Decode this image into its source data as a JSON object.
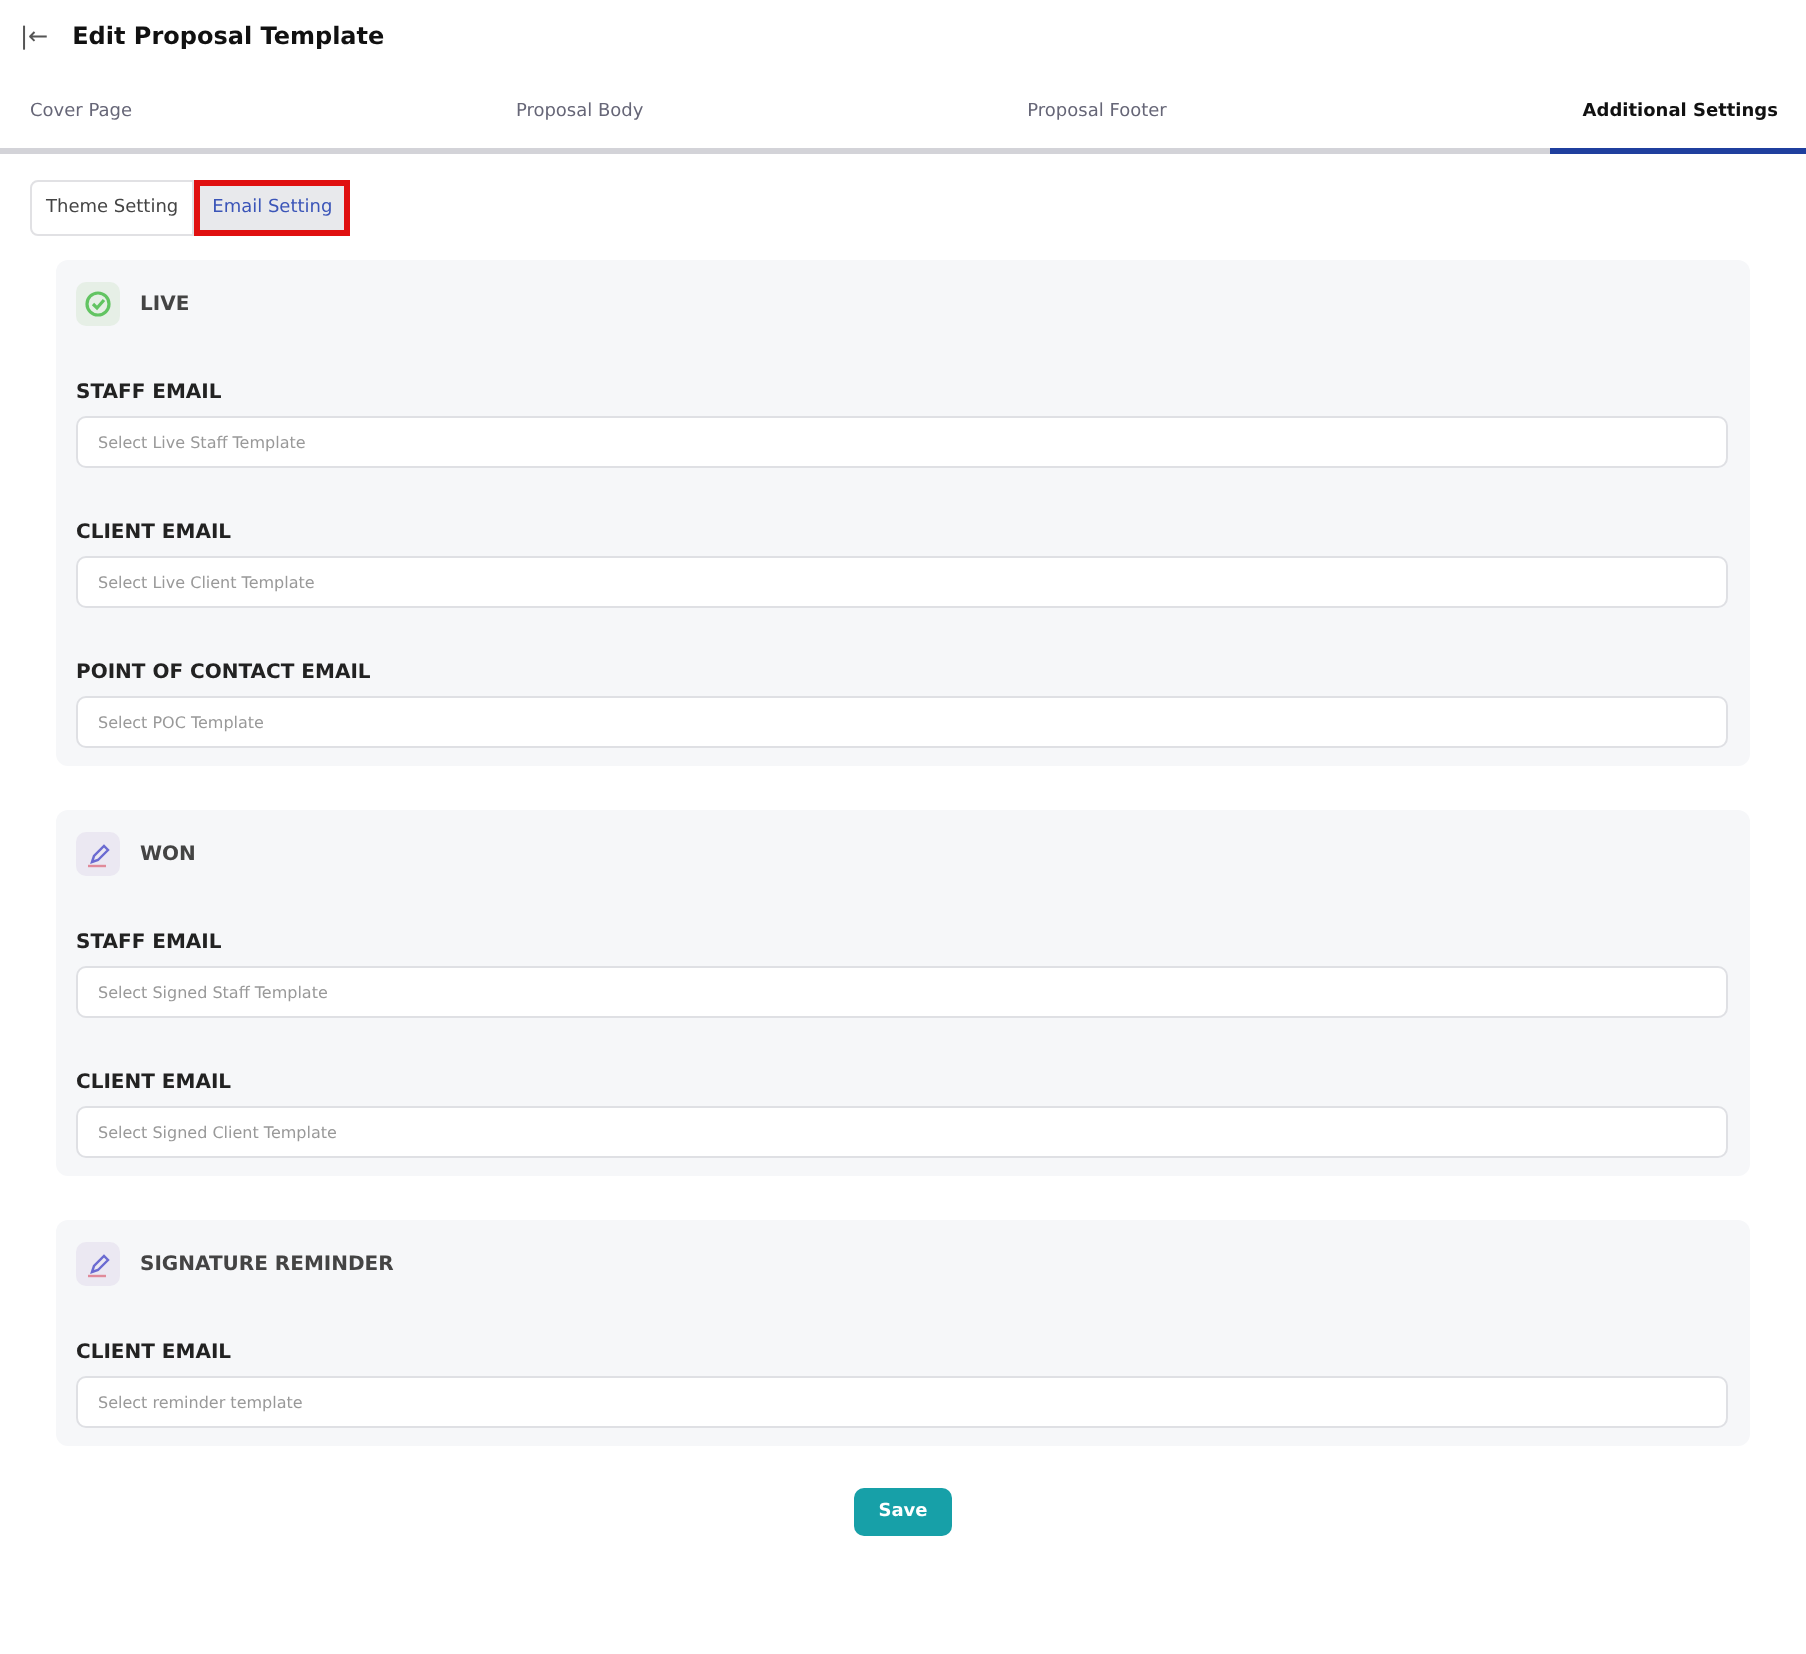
{
  "header": {
    "back_icon": "|←",
    "title": "Edit Proposal Template"
  },
  "tabs": [
    {
      "label": "Cover Page",
      "selected": false
    },
    {
      "label": "Proposal Body",
      "selected": false
    },
    {
      "label": "Proposal Footer",
      "selected": false
    },
    {
      "label": "Additional Settings",
      "selected": true
    }
  ],
  "sub_tabs": [
    {
      "label": "Theme Setting",
      "selected": false,
      "highlighted": false
    },
    {
      "label": "Email Setting",
      "selected": true,
      "highlighted": true
    }
  ],
  "sections": [
    {
      "title": "LIVE",
      "kind": "check",
      "fields": [
        {
          "label": "STAFF EMAIL",
          "placeholder": "Select Live Staff Template"
        },
        {
          "label": "CLIENT EMAIL",
          "placeholder": "Select Live Client Template"
        },
        {
          "label": "POINT OF CONTACT EMAIL",
          "placeholder": "Select POC Template"
        }
      ]
    },
    {
      "title": "WON",
      "kind": "pen",
      "fields": [
        {
          "label": "STAFF EMAIL",
          "placeholder": "Select Signed Staff Template"
        },
        {
          "label": "CLIENT EMAIL",
          "placeholder": "Select Signed Client Template"
        }
      ]
    },
    {
      "title": "SIGNATURE REMINDER",
      "kind": "pen",
      "fields": [
        {
          "label": "CLIENT EMAIL",
          "placeholder": "Select reminder template"
        }
      ]
    }
  ],
  "save_button": "Save"
}
